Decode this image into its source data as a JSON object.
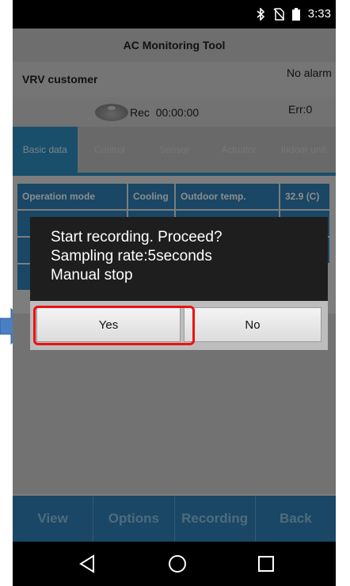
{
  "status_bar": {
    "time": "3:33",
    "icons": [
      "bluetooth-icon",
      "no-sim-icon",
      "battery-icon"
    ]
  },
  "app": {
    "title": "AC Monitoring Tool",
    "customer": "VRV customer",
    "alarm_status": "No alarm",
    "rec_label": "Rec",
    "rec_time": "00:00:00",
    "error_count": "Err:0"
  },
  "tabs": [
    {
      "label": "Basic data",
      "active": true
    },
    {
      "label": "Control",
      "active": false
    },
    {
      "label": "Sensor",
      "active": false
    },
    {
      "label": "Actuator",
      "active": false
    },
    {
      "label": "Indoor unit",
      "active": false
    }
  ],
  "data_table": {
    "row1": {
      "label": "Operation mode",
      "mode": "Cooling",
      "outdoor_label": "Outdoor temp.",
      "outdoor_value": "32.9 (C)"
    }
  },
  "dialog": {
    "line1": "Start recording. Proceed?",
    "line2": "Sampling rate:5seconds",
    "line3": "Manual stop",
    "yes_label": "Yes",
    "no_label": "No"
  },
  "bottom_bar": [
    "View",
    "Options",
    "Recording",
    "Back"
  ],
  "colors": {
    "accent": "#2f82b8",
    "highlight": "#e11111"
  }
}
